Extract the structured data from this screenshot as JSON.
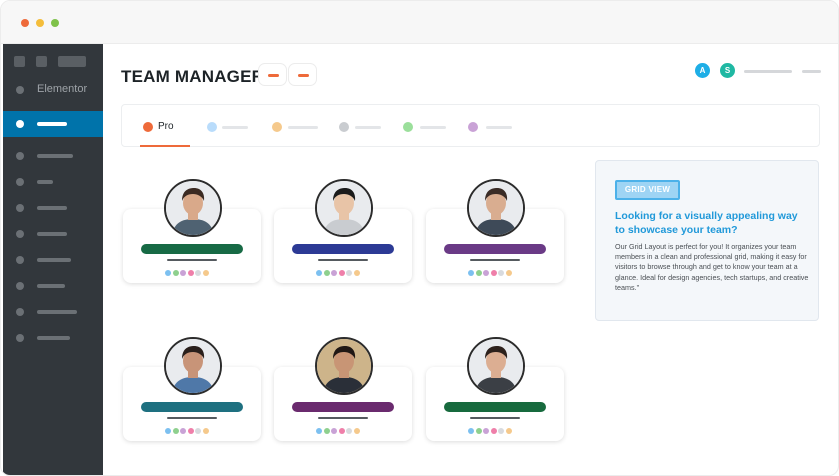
{
  "window": {
    "traffic_lights": [
      {
        "name": "close-dot",
        "color": "#ee6a3a"
      },
      {
        "name": "minimize-dot",
        "color": "#f4bd3b"
      },
      {
        "name": "zoom-dot",
        "color": "#7fc24a"
      }
    ]
  },
  "sidebar": {
    "brand_label": "Elementor",
    "active_color": "#0073aa"
  },
  "header": {
    "title": "TEAM MANAGER",
    "avatars": [
      {
        "letter": "A",
        "color": "#1eaee6"
      },
      {
        "letter": "S",
        "color": "#1fb8a3"
      }
    ]
  },
  "tabs": [
    {
      "label": "Pro",
      "color": "#ee6a3a",
      "active": true
    },
    {
      "label": "",
      "color": "#b9dcfb"
    },
    {
      "label": "",
      "color": "#f5c98c"
    },
    {
      "label": "",
      "color": "#c9ccd0"
    },
    {
      "label": "",
      "color": "#9bdf9b"
    },
    {
      "label": "",
      "color": "#c9a2d6"
    }
  ],
  "team_cards": [
    {
      "name_bar_color": "#176a45",
      "skin": "#d9a98a",
      "hair": "#3b2a22",
      "shirt": "#4f6272"
    },
    {
      "name_bar_color": "#2c3a95",
      "skin": "#e8c4a7",
      "hair": "#1b1b1b",
      "shirt": "#c9ccd0"
    },
    {
      "name_bar_color": "#6a3a86",
      "skin": "#d9ad90",
      "hair": "#3a2c26",
      "shirt": "#3e4a58"
    },
    {
      "name_bar_color": "#1e7080",
      "skin": "#c89478",
      "hair": "#2a1f1b",
      "shirt": "#4f78a8"
    },
    {
      "name_bar_color": "#6a2a6e",
      "skin": "#c89575",
      "hair": "#201815",
      "shirt": "#2a2f38"
    },
    {
      "name_bar_color": "#176a3e",
      "skin": "#dcae92",
      "hair": "#2d211c",
      "shirt": "#3b3f45"
    }
  ],
  "social_colors": [
    "#7cc0f0",
    "#8ed08e",
    "#c9a2d6",
    "#ef7fa9",
    "#d8dade",
    "#f5c98c"
  ],
  "info": {
    "button_label": "GRID VIEW",
    "heading": "Looking for a visually appealing way to showcase your team?",
    "body": "Our Grid Layout is perfect for you! It organizes your team members in a clean and professional grid, making it easy for visitors to browse through and get to know your team at a glance. Ideal for design agencies, tech startups, and creative teams.\""
  }
}
